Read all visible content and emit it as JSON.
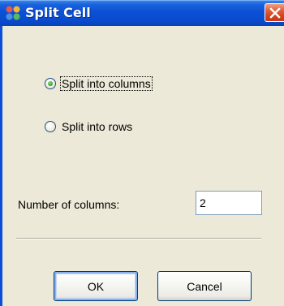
{
  "window": {
    "title": "Split Cell",
    "app_icon": "puzzle-icon",
    "close_icon": "close-icon",
    "titlebar_color": "#0b50d6",
    "dialog_bg": "#ece9d8"
  },
  "options": {
    "split_columns_label": "Split into columns",
    "split_columns_selected": true,
    "split_rows_label": "Split into rows",
    "split_rows_selected": false
  },
  "number_field": {
    "label": "Number of columns:",
    "value": "2"
  },
  "buttons": {
    "ok_label": "OK",
    "cancel_label": "Cancel"
  }
}
